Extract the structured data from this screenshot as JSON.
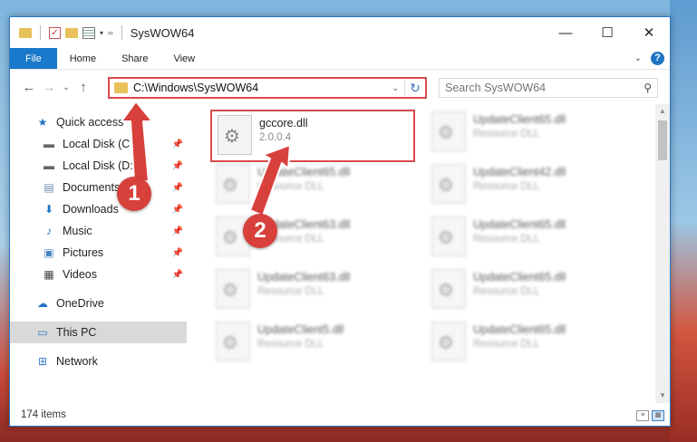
{
  "window": {
    "title": "SysWOW64",
    "controls": {
      "minimize": "—",
      "maximize": "☐",
      "close": "✕"
    }
  },
  "ribbon": {
    "tabs": [
      "File",
      "Home",
      "Share",
      "View"
    ],
    "help": "?"
  },
  "nav": {
    "address_path": "C:\\Windows\\SysWOW64",
    "search_placeholder": "Search SysWOW64"
  },
  "sidebar": {
    "quick_access": "Quick access",
    "items": [
      {
        "label": "Local Disk (C:)",
        "icon": "drive-icon",
        "pinned": true
      },
      {
        "label": "Local Disk (D:)",
        "icon": "drive-icon",
        "pinned": true
      },
      {
        "label": "Documents",
        "icon": "documents-icon",
        "pinned": true
      },
      {
        "label": "Downloads",
        "icon": "downloads-icon",
        "pinned": true
      },
      {
        "label": "Music",
        "icon": "music-icon",
        "pinned": true
      },
      {
        "label": "Pictures",
        "icon": "pictures-icon",
        "pinned": true
      },
      {
        "label": "Videos",
        "icon": "videos-icon",
        "pinned": true
      }
    ],
    "onedrive": "OneDrive",
    "this_pc": "This PC",
    "network": "Network"
  },
  "files": [
    {
      "name": "gccore.dll",
      "sub": "2.0.0.4",
      "highlighted": true
    },
    {
      "name": "UpdateClient65.dll",
      "sub": "Resource DLL"
    },
    {
      "name": "UpdateClient65.dll",
      "sub": "Resource DLL"
    },
    {
      "name": "UpdateClient42.dll",
      "sub": "Resource DLL"
    },
    {
      "name": "UpdateClient63.dll",
      "sub": "Resource DLL"
    },
    {
      "name": "UpdateClient65.dll",
      "sub": "Resource DLL"
    },
    {
      "name": "UpdateClient63.dll",
      "sub": "Resource DLL"
    },
    {
      "name": "UpdateClient65.dll",
      "sub": "Resource DLL"
    },
    {
      "name": "UpdateClient5.dll",
      "sub": "Resource DLL"
    },
    {
      "name": "UpdateClient65.dll",
      "sub": "Resource DLL"
    }
  ],
  "status": {
    "item_count": "174 items"
  },
  "annotations": {
    "step1": "1",
    "step2": "2"
  },
  "colors": {
    "accent": "#1979ca",
    "highlight": "#d94a4a",
    "badge": "#d8403c"
  }
}
